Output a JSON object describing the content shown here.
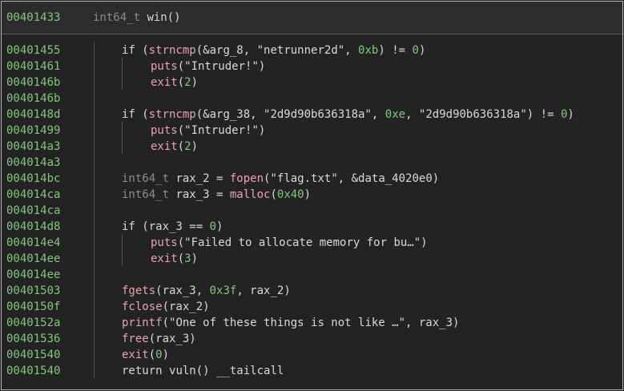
{
  "function_header": {
    "address": "00401433",
    "return_type": "int64_t",
    "name": "win",
    "params": "()"
  },
  "lines": [
    {
      "address": "00401455",
      "parts": [
        [
          "kw",
          "if ("
        ],
        [
          "fn",
          "strncmp"
        ],
        [
          "kw",
          "(&arg_8, \""
        ],
        [
          "str",
          "netrunner2d"
        ],
        [
          "kw",
          "\", "
        ],
        [
          "num",
          "0xb"
        ],
        [
          "kw",
          ") != "
        ],
        [
          "num",
          "0"
        ],
        [
          "kw",
          ")"
        ]
      ]
    },
    {
      "address": "00401461",
      "parts": [
        [
          "fn",
          "puts"
        ],
        [
          "kw",
          "(\""
        ],
        [
          "str",
          "Intruder!"
        ],
        [
          "kw",
          "\")"
        ]
      ]
    },
    {
      "address": "0040146b",
      "parts": [
        [
          "fn",
          "exit"
        ],
        [
          "kw",
          "("
        ],
        [
          "num",
          "2"
        ],
        [
          "kw",
          ")"
        ]
      ]
    },
    {
      "address": "0040146b",
      "parts": []
    },
    {
      "address": "0040148d",
      "parts": [
        [
          "kw",
          "if ("
        ],
        [
          "fn",
          "strncmp"
        ],
        [
          "kw",
          "(&arg_38, \""
        ],
        [
          "str",
          "2d9d90b636318a"
        ],
        [
          "kw",
          "\", "
        ],
        [
          "num",
          "0xe"
        ],
        [
          "kw",
          ", \""
        ],
        [
          "str",
          "2d9d90b636318a"
        ],
        [
          "kw",
          "\") != "
        ],
        [
          "num",
          "0"
        ],
        [
          "kw",
          ")"
        ]
      ]
    },
    {
      "address": "00401499",
      "parts": [
        [
          "fn",
          "puts"
        ],
        [
          "kw",
          "(\""
        ],
        [
          "str",
          "Intruder!"
        ],
        [
          "kw",
          "\")"
        ]
      ]
    },
    {
      "address": "004014a3",
      "parts": [
        [
          "fn",
          "exit"
        ],
        [
          "kw",
          "("
        ],
        [
          "num",
          "2"
        ],
        [
          "kw",
          ")"
        ]
      ]
    },
    {
      "address": "004014a3",
      "parts": []
    },
    {
      "address": "004014bc",
      "parts": [
        [
          "type",
          "int64_t "
        ],
        [
          "kw",
          "rax_2 = "
        ],
        [
          "fn",
          "fopen"
        ],
        [
          "kw",
          "(\""
        ],
        [
          "str",
          "flag.txt"
        ],
        [
          "kw",
          "\", &data_4020e0)"
        ]
      ]
    },
    {
      "address": "004014ca",
      "parts": [
        [
          "type",
          "int64_t "
        ],
        [
          "kw",
          "rax_3 = "
        ],
        [
          "fn",
          "malloc"
        ],
        [
          "kw",
          "("
        ],
        [
          "num",
          "0x40"
        ],
        [
          "kw",
          ")"
        ]
      ]
    },
    {
      "address": "004014ca",
      "parts": []
    },
    {
      "address": "004014d8",
      "parts": [
        [
          "kw",
          "if (rax_3 == "
        ],
        [
          "num",
          "0"
        ],
        [
          "kw",
          ")"
        ]
      ]
    },
    {
      "address": "004014e4",
      "parts": [
        [
          "fn",
          "puts"
        ],
        [
          "kw",
          "(\""
        ],
        [
          "str",
          "Failed to allocate memory for bu…"
        ],
        [
          "kw",
          "\")"
        ]
      ]
    },
    {
      "address": "004014ee",
      "parts": [
        [
          "fn",
          "exit"
        ],
        [
          "kw",
          "("
        ],
        [
          "num",
          "3"
        ],
        [
          "kw",
          ")"
        ]
      ]
    },
    {
      "address": "004014ee",
      "parts": []
    },
    {
      "address": "00401503",
      "parts": [
        [
          "fn",
          "fgets"
        ],
        [
          "kw",
          "(rax_3, "
        ],
        [
          "num",
          "0x3f"
        ],
        [
          "kw",
          ", rax_2)"
        ]
      ]
    },
    {
      "address": "0040150f",
      "parts": [
        [
          "fn",
          "fclose"
        ],
        [
          "kw",
          "(rax_2)"
        ]
      ]
    },
    {
      "address": "0040152a",
      "parts": [
        [
          "fn",
          "printf"
        ],
        [
          "kw",
          "(\""
        ],
        [
          "str",
          "One of these things is not like …"
        ],
        [
          "kw",
          "\", rax_3)"
        ]
      ]
    },
    {
      "address": "00401536",
      "parts": [
        [
          "fn",
          "free"
        ],
        [
          "kw",
          "(rax_3)"
        ]
      ]
    },
    {
      "address": "00401540",
      "parts": [
        [
          "fn",
          "exit"
        ],
        [
          "kw",
          "("
        ],
        [
          "num",
          "0"
        ],
        [
          "kw",
          ")"
        ]
      ]
    },
    {
      "address": "00401540",
      "parts": [
        [
          "kw",
          "return "
        ],
        [
          "kw",
          "vuln() __tailcall"
        ]
      ]
    }
  ],
  "indent_levels": [
    1,
    2,
    2,
    0,
    1,
    2,
    2,
    0,
    1,
    1,
    0,
    1,
    2,
    2,
    0,
    1,
    1,
    1,
    1,
    1,
    1
  ],
  "colors": {
    "background": "#232323",
    "address": "#83c77b",
    "function_call": "#e8a3ad",
    "number": "#83c77b",
    "type": "#8c8c8c",
    "text": "#d9d9d9"
  }
}
